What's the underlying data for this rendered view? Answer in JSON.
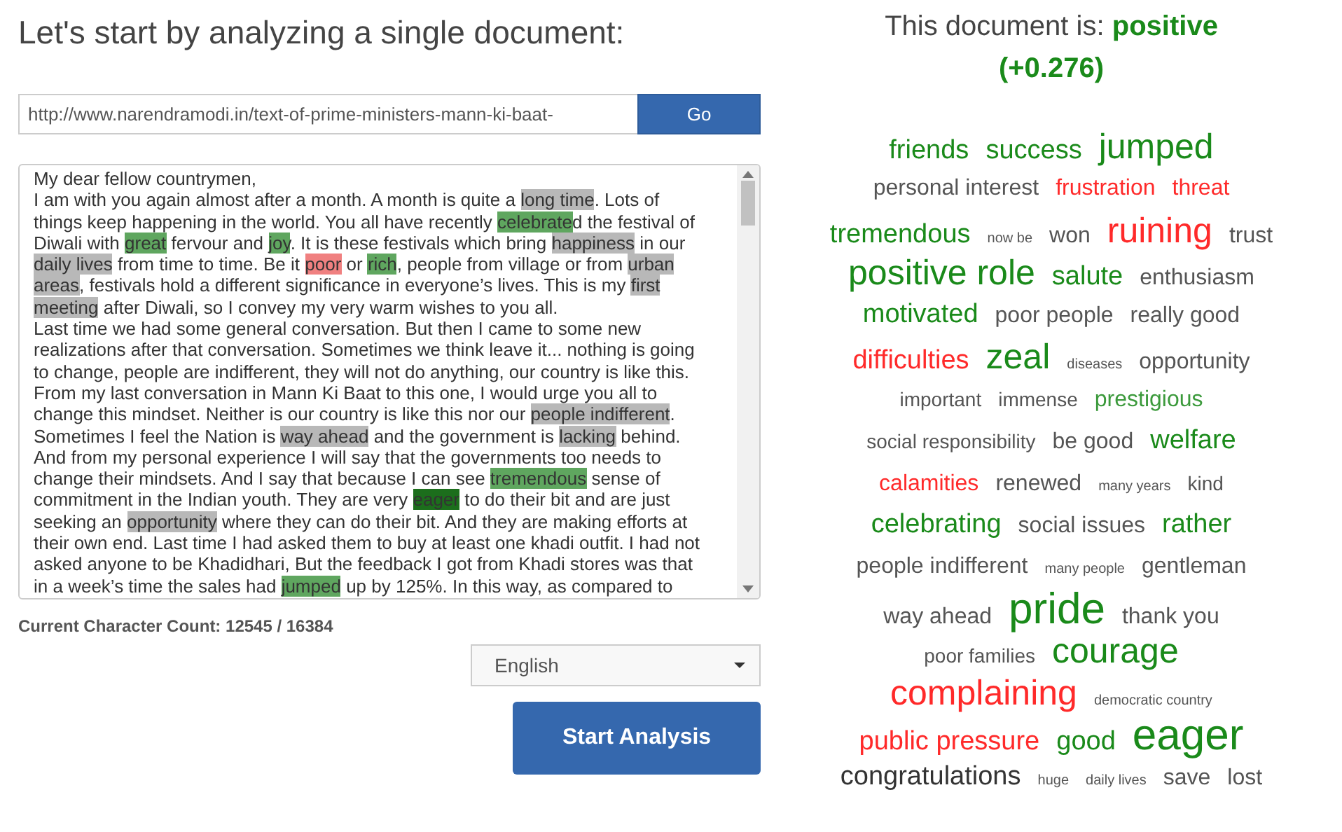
{
  "heading": "Let's start by analyzing a single document:",
  "url_field": {
    "value": "http://www.narendramodi.in/text-of-prime-ministers-mann-ki-baat-"
  },
  "go_button": "Go",
  "document": {
    "lines": [
      [
        {
          "text": "My dear fellow countrymen,",
          "kind": "plain"
        }
      ],
      [
        {
          "text": "I am with you again almost after a month. A month is quite a ",
          "kind": "plain"
        },
        {
          "text": "long time",
          "kind": "neutral"
        },
        {
          "text": ". Lots of",
          "kind": "plain"
        }
      ],
      [
        {
          "text": "things keep happening in the world. You all have recently ",
          "kind": "plain"
        },
        {
          "text": "celebrate",
          "kind": "positive"
        },
        {
          "text": "d the festival of",
          "kind": "plain"
        }
      ],
      [
        {
          "text": "Diwali with ",
          "kind": "plain"
        },
        {
          "text": "great",
          "kind": "positive"
        },
        {
          "text": " fervour and ",
          "kind": "plain"
        },
        {
          "text": "joy",
          "kind": "positive"
        },
        {
          "text": ". It is these festivals which bring ",
          "kind": "plain"
        },
        {
          "text": "happiness",
          "kind": "neutral"
        },
        {
          "text": " in our",
          "kind": "plain"
        }
      ],
      [
        {
          "text": "daily lives",
          "kind": "neutral"
        },
        {
          "text": " from time to time. Be it ",
          "kind": "plain"
        },
        {
          "text": "poor",
          "kind": "negative"
        },
        {
          "text": " or ",
          "kind": "plain"
        },
        {
          "text": "rich",
          "kind": "positive"
        },
        {
          "text": ", people from village or from ",
          "kind": "plain"
        },
        {
          "text": "urban",
          "kind": "neutral"
        }
      ],
      [
        {
          "text": "areas",
          "kind": "neutral"
        },
        {
          "text": ", festivals hold a different significance in everyone’s lives. This is my ",
          "kind": "plain"
        },
        {
          "text": "first",
          "kind": "neutral"
        }
      ],
      [
        {
          "text": "meeting",
          "kind": "neutral"
        },
        {
          "text": " after Diwali, so I convey my very warm wishes to you all.",
          "kind": "plain"
        }
      ],
      [
        {
          "text": "Last time we had some general conversation. But then I came to some new",
          "kind": "plain"
        }
      ],
      [
        {
          "text": "realizations after that conversation. Sometimes we think leave it... nothing is going",
          "kind": "plain"
        }
      ],
      [
        {
          "text": "to change, people are indifferent, they will not do anything, our country is like this.",
          "kind": "plain"
        }
      ],
      [
        {
          "text": "From my last conversation in Mann Ki Baat to this one, I would urge you all to",
          "kind": "plain"
        }
      ],
      [
        {
          "text": "change this mindset. Neither is our country is like this nor our ",
          "kind": "plain"
        },
        {
          "text": "people indifferent",
          "kind": "neutral"
        },
        {
          "text": ".",
          "kind": "plain"
        }
      ],
      [
        {
          "text": "Sometimes I feel the Nation is ",
          "kind": "plain"
        },
        {
          "text": "way ahead",
          "kind": "neutral"
        },
        {
          "text": " and the government is ",
          "kind": "plain"
        },
        {
          "text": "lacking",
          "kind": "neutral"
        },
        {
          "text": " behind.",
          "kind": "plain"
        }
      ],
      [
        {
          "text": "And from my personal experience I will say that the governments too needs to",
          "kind": "plain"
        }
      ],
      [
        {
          "text": "change their mindsets. And I say that because I can see ",
          "kind": "plain"
        },
        {
          "text": "tremendous",
          "kind": "positive"
        },
        {
          "text": " sense of",
          "kind": "plain"
        }
      ],
      [
        {
          "text": "commitment in the Indian youth. They are very ",
          "kind": "plain"
        },
        {
          "text": "eager",
          "kind": "strong"
        },
        {
          "text": " to do their bit and are just",
          "kind": "plain"
        }
      ],
      [
        {
          "text": "seeking an ",
          "kind": "plain"
        },
        {
          "text": "opportunity",
          "kind": "neutral"
        },
        {
          "text": " where they can do their bit. And they are making efforts at",
          "kind": "plain"
        }
      ],
      [
        {
          "text": "their own end. Last time I had asked them to buy at least one khadi outfit. I had not",
          "kind": "plain"
        }
      ],
      [
        {
          "text": "asked anyone to be Khadidhari, But the feedback I got from Khadi stores was that",
          "kind": "plain"
        }
      ],
      [
        {
          "text": "in a week’s time the sales had ",
          "kind": "plain"
        },
        {
          "text": "jumped",
          "kind": "positive"
        },
        {
          "text": " up by 125%. In this way, as compared to",
          "kind": "plain"
        }
      ]
    ]
  },
  "character_count": "Current Character Count: 12545 / 16384",
  "language_select": {
    "value": "English"
  },
  "start_button": "Start Analysis",
  "result": {
    "prefix": "This document is:",
    "sentiment": "positive",
    "score": "(+0.276)",
    "color": "#1a8a1a"
  },
  "word_cloud": {
    "rows": [
      [
        {
          "text": "friends",
          "kind": "m",
          "color": "#1a8a1a"
        },
        {
          "text": "success",
          "kind": "m",
          "color": "#1a8a1a"
        },
        {
          "text": "jumped",
          "kind": "l",
          "color": "#1a8a1a"
        }
      ],
      [
        {
          "text": "personal interest",
          "kind": "s",
          "color": "#555555"
        },
        {
          "text": "frustration",
          "kind": "s",
          "color": "#ff2a2a"
        },
        {
          "text": "threat",
          "kind": "s",
          "color": "#ff2a2a"
        }
      ],
      [
        {
          "text": "tremendous",
          "kind": "m",
          "color": "#1a8a1a"
        },
        {
          "text": "now be",
          "kind": "xs",
          "color": "#555555"
        },
        {
          "text": "won",
          "kind": "s",
          "color": "#555555"
        },
        {
          "text": "ruining",
          "kind": "l",
          "color": "#ff2a2a"
        },
        {
          "text": "trust",
          "kind": "s",
          "color": "#555555"
        }
      ],
      [
        {
          "text": "positive role",
          "kind": "l",
          "color": "#1a8a1a"
        },
        {
          "text": "salute",
          "kind": "m",
          "color": "#1a8a1a"
        },
        {
          "text": "enthusiasm",
          "kind": "s",
          "color": "#555555"
        }
      ],
      [
        {
          "text": "motivated",
          "kind": "m",
          "color": "#1a8a1a"
        },
        {
          "text": "poor people",
          "kind": "s",
          "color": "#555555"
        },
        {
          "text": "really good",
          "kind": "s",
          "color": "#555555"
        }
      ],
      [
        {
          "text": "difficulties",
          "kind": "m",
          "color": "#ff2a2a"
        },
        {
          "text": "zeal",
          "kind": "l",
          "color": "#1a8a1a"
        },
        {
          "text": "diseases",
          "kind": "xs",
          "color": "#555555"
        },
        {
          "text": "opportunity",
          "kind": "s",
          "color": "#555555"
        }
      ],
      [
        {
          "text": "important",
          "kind": "sm",
          "color": "#555555"
        },
        {
          "text": "immense",
          "kind": "sm",
          "color": "#555555"
        },
        {
          "text": "prestigious",
          "kind": "s",
          "color": "#3c9a3c"
        }
      ],
      [
        {
          "text": "social responsibility",
          "kind": "sm",
          "color": "#555555"
        },
        {
          "text": "be good",
          "kind": "s",
          "color": "#555555"
        },
        {
          "text": "welfare",
          "kind": "m",
          "color": "#1a8a1a"
        }
      ],
      [
        {
          "text": "calamities",
          "kind": "s",
          "color": "#ff2a2a"
        },
        {
          "text": "renewed",
          "kind": "s",
          "color": "#555555"
        },
        {
          "text": "many years",
          "kind": "xs",
          "color": "#555555"
        },
        {
          "text": "kind",
          "kind": "sm",
          "color": "#555555"
        }
      ],
      [
        {
          "text": "celebrating",
          "kind": "m",
          "color": "#1a8a1a"
        },
        {
          "text": "social issues",
          "kind": "s",
          "color": "#555555"
        },
        {
          "text": "rather",
          "kind": "m",
          "color": "#1a8a1a"
        }
      ],
      [
        {
          "text": "people indifferent",
          "kind": "s",
          "color": "#555555"
        },
        {
          "text": "many people",
          "kind": "xs",
          "color": "#555555"
        },
        {
          "text": "gentleman",
          "kind": "s",
          "color": "#555555"
        }
      ],
      [
        {
          "text": "way ahead",
          "kind": "s",
          "color": "#555555"
        },
        {
          "text": "pride",
          "kind": "xl",
          "color": "#1a8a1a"
        },
        {
          "text": "thank you",
          "kind": "s",
          "color": "#555555"
        }
      ],
      [
        {
          "text": "poor families",
          "kind": "sm",
          "color": "#555555"
        },
        {
          "text": "courage",
          "kind": "l",
          "color": "#1a8a1a"
        }
      ],
      [
        {
          "text": "complaining",
          "kind": "l",
          "color": "#ff2a2a"
        },
        {
          "text": "democratic country",
          "kind": "xs",
          "color": "#555555"
        }
      ],
      [
        {
          "text": "public pressure",
          "kind": "m",
          "color": "#ff2a2a"
        },
        {
          "text": "good",
          "kind": "m",
          "color": "#1a8a1a"
        },
        {
          "text": "eager",
          "kind": "xl",
          "color": "#1a8a1a"
        }
      ],
      [
        {
          "text": "congratulations",
          "kind": "m",
          "color": "#333333"
        },
        {
          "text": "huge",
          "kind": "xs",
          "color": "#555555"
        },
        {
          "text": "daily lives",
          "kind": "xs",
          "color": "#555555"
        },
        {
          "text": "save",
          "kind": "s",
          "color": "#555555"
        },
        {
          "text": "lost",
          "kind": "s",
          "color": "#555555"
        }
      ]
    ]
  }
}
